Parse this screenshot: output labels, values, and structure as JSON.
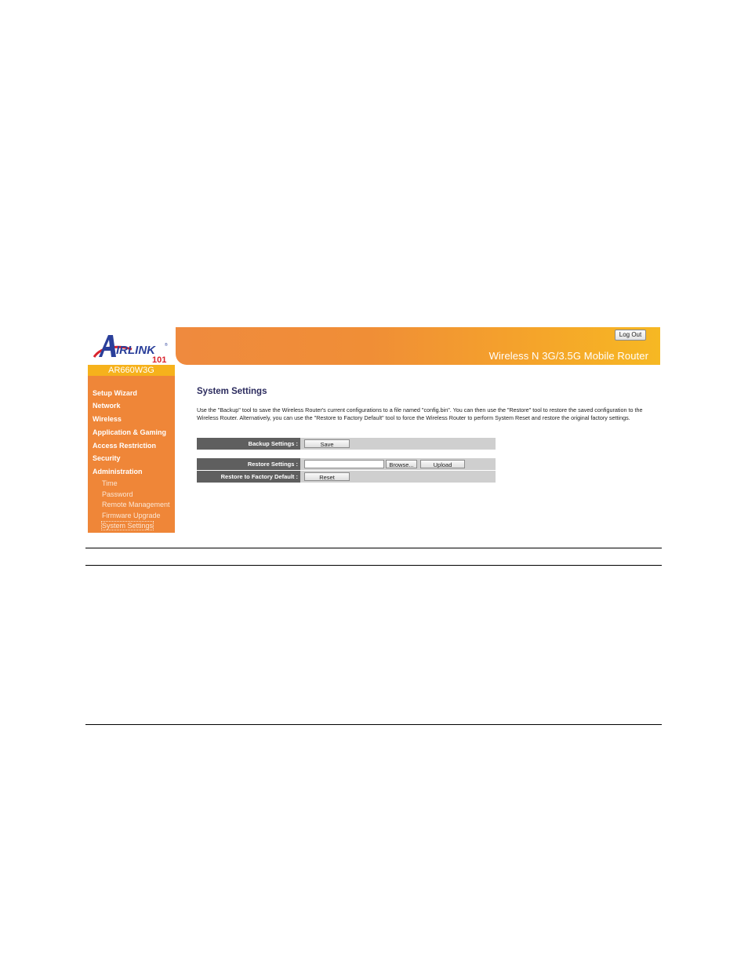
{
  "brand": {
    "logo_text": "AIRLINK",
    "logo_number": "101",
    "model": "AR660W3G",
    "logo_colors": {
      "blue": "#2a3f9a",
      "red": "#d9232d"
    }
  },
  "header": {
    "logout_label": "Log Out",
    "product_title": "Wireless N 3G/3.5G Mobile Router"
  },
  "sidebar": {
    "main_items": [
      {
        "label": "Setup Wizard"
      },
      {
        "label": "Network"
      },
      {
        "label": "Wireless"
      },
      {
        "label": "Application & Gaming"
      },
      {
        "label": "Access Restriction"
      },
      {
        "label": "Security"
      },
      {
        "label": "Administration"
      }
    ],
    "sub_items": [
      {
        "label": "Time"
      },
      {
        "label": "Password"
      },
      {
        "label": "Remote Management"
      },
      {
        "label": "Firmware Upgrade"
      },
      {
        "label": "System Settings",
        "active": true
      }
    ]
  },
  "main": {
    "title": "System Settings",
    "description": "Use the \"Backup\" tool to save the Wireless Router's current configurations to a file named \"config.bin\". You can then use the \"Restore\" tool to restore the saved configuration to the Wireless Router. Alternatively, you can use the \"Restore to Factory Default\" tool to force the Wireless Router to perform System Reset and restore the original factory settings.",
    "backup": {
      "label": "Backup Settings :",
      "button": "Save"
    },
    "restore": {
      "label": "Restore Settings :",
      "file_value": "",
      "browse_button": "Browse...",
      "upload_button": "Upload"
    },
    "factory": {
      "label": "Restore to Factory Default :",
      "button": "Reset"
    }
  },
  "colors": {
    "sidebar_orange": "#ef8638",
    "model_bar_yellow": "#f6b21c",
    "row_label_bg": "#5f5f5f",
    "row_bg": "#cfcfcf",
    "title_color": "#2b2b5e"
  }
}
